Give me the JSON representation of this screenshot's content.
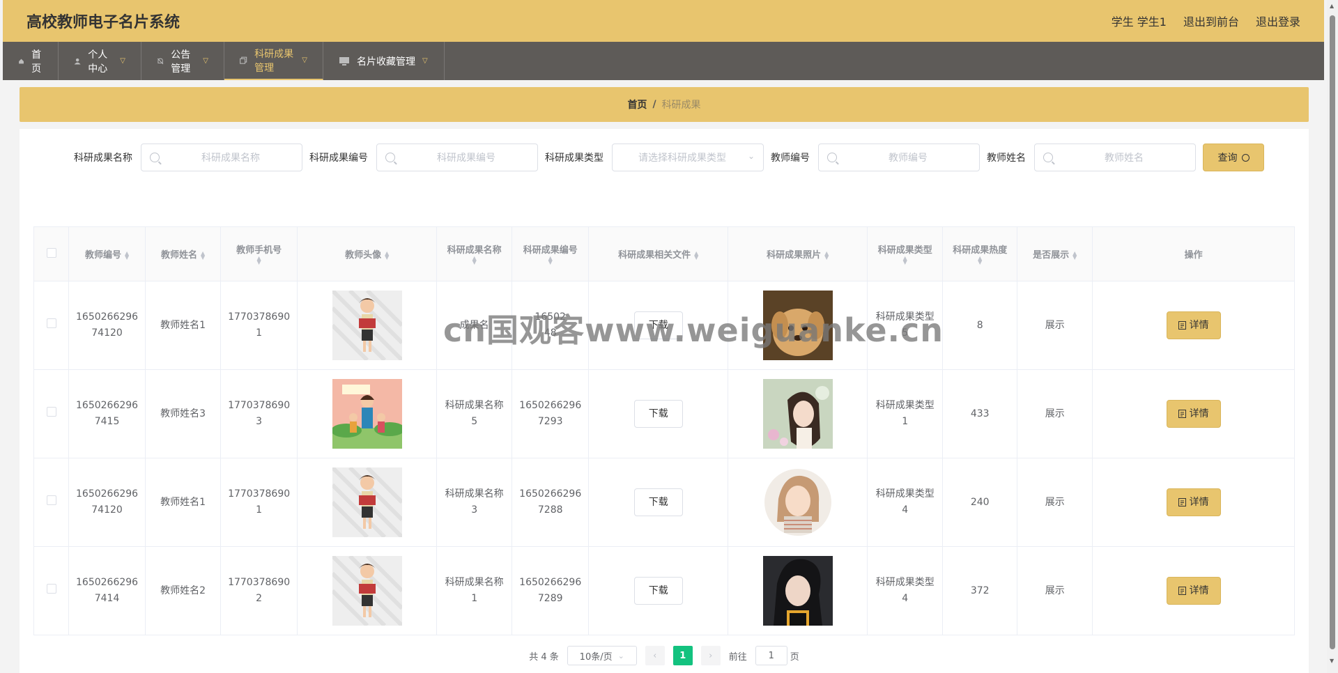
{
  "header": {
    "title": "高校教师电子名片系统",
    "user": "学生 学生1",
    "front_link": "退出到前台",
    "logout": "退出登录"
  },
  "nav": [
    {
      "label": "首页",
      "icon": "home-icon",
      "caret": false
    },
    {
      "label": "个人中心",
      "icon": "user-icon",
      "caret": true
    },
    {
      "label": "公告管理",
      "icon": "bell-icon",
      "caret": true
    },
    {
      "label": "科研成果管理",
      "icon": "copy-icon",
      "caret": true,
      "active": true
    },
    {
      "label": "名片收藏管理",
      "icon": "monitor-icon",
      "caret": true
    }
  ],
  "breadcrumb": {
    "home": "首页",
    "sep": "/",
    "current": "科研成果"
  },
  "filters": {
    "name_label": "科研成果名称",
    "name_placeholder": "科研成果名称",
    "code_label": "科研成果编号",
    "code_placeholder": "科研成果编号",
    "type_label": "科研成果类型",
    "type_placeholder": "请选择科研成果类型",
    "tno_label": "教师编号",
    "tno_placeholder": "教师编号",
    "tname_label": "教师姓名",
    "tname_placeholder": "教师姓名",
    "query_label": "查询"
  },
  "table": {
    "headers": [
      "教师编号",
      "教师姓名",
      "教师手机号",
      "教师头像",
      "科研成果名称",
      "科研成果编号",
      "科研成果相关文件",
      "科研成果照片",
      "科研成果类型",
      "科研成果热度",
      "是否展示",
      "操作"
    ],
    "download_label": "下载",
    "detail_label": "详情",
    "rows": [
      {
        "teacher_no": "165026629674120",
        "teacher_no_l1": "1650266296",
        "teacher_no_l2": "74120",
        "teacher_name": "教师姓名1",
        "phone_l1": "1770378690",
        "phone_l2": "1",
        "achv_name_l1": "成果名",
        "achv_name_l2": "",
        "achv_code_l1": "16502",
        "achv_code_l2": "48",
        "achv_type_l1": "科研成果类型",
        "achv_type_l2": "5",
        "heat": "8",
        "show": "展示",
        "avatar": "teacher-reading",
        "photo": "puppy"
      },
      {
        "teacher_no": "16502662967415",
        "teacher_no_l1": "1650266296",
        "teacher_no_l2": "7415",
        "teacher_name": "教师姓名3",
        "phone_l1": "1770378690",
        "phone_l2": "3",
        "achv_name_l1": "科研成果名称",
        "achv_name_l2": "5",
        "achv_code_l1": "1650266296",
        "achv_code_l2": "7293",
        "achv_type_l1": "科研成果类型",
        "achv_type_l2": "1",
        "heat": "433",
        "show": "展示",
        "avatar": "teacher-kids",
        "photo": "girl-flowers"
      },
      {
        "teacher_no": "165026629674120",
        "teacher_no_l1": "1650266296",
        "teacher_no_l2": "74120",
        "teacher_name": "教师姓名1",
        "phone_l1": "1770378690",
        "phone_l2": "1",
        "achv_name_l1": "科研成果名称",
        "achv_name_l2": "3",
        "achv_code_l1": "1650266296",
        "achv_code_l2": "7288",
        "achv_type_l1": "科研成果类型",
        "achv_type_l2": "4",
        "heat": "240",
        "show": "展示",
        "avatar": "teacher-reading",
        "photo": "girl-drawing"
      },
      {
        "teacher_no": "16502662967414",
        "teacher_no_l1": "1650266296",
        "teacher_no_l2": "7414",
        "teacher_name": "教师姓名2",
        "phone_l1": "1770378690",
        "phone_l2": "2",
        "achv_name_l1": "科研成果名称",
        "achv_name_l2": "1",
        "achv_code_l1": "1650266296",
        "achv_code_l2": "7289",
        "achv_type_l1": "科研成果类型",
        "achv_type_l2": "4",
        "heat": "372",
        "show": "展示",
        "avatar": "teacher-reading",
        "photo": "girl-dark"
      }
    ]
  },
  "pagination": {
    "total": "共 4 条",
    "page_size": "10条/页",
    "current": "1",
    "goto_prefix": "前往",
    "goto_value": "1",
    "goto_suffix": "页"
  },
  "watermark": "cn国观客www.weiguanke.cn",
  "colors": {
    "accent": "#e8c56e",
    "nav_bg": "#5e5b58",
    "page_active": "#13c27f"
  }
}
